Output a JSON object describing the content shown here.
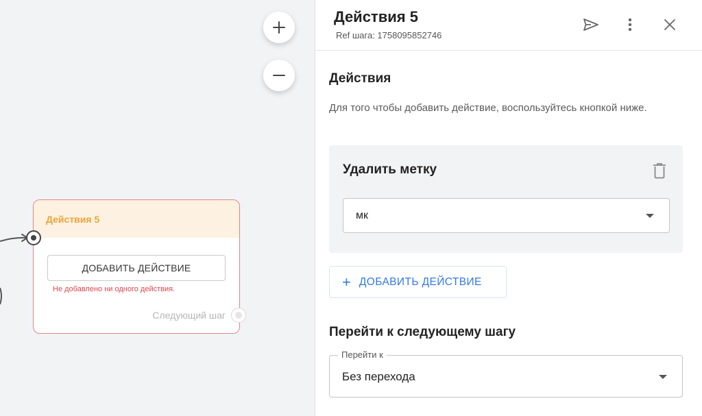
{
  "canvas": {
    "zoom_in_label": "+",
    "zoom_out_label": "−",
    "node": {
      "title": "Действия 5",
      "add_button": "ДОБАВИТЬ ДЕЙСТВИЕ",
      "error": "Не добавлено ни одного действия.",
      "next_step": "Следующий шаг"
    }
  },
  "panel": {
    "title": "Действия 5",
    "ref": "Ref шага: 1758095852746",
    "icons": [
      "send-icon",
      "more-vertical-icon",
      "close-icon"
    ],
    "actions_section": {
      "title": "Действия",
      "hint": "Для того чтобы добавить действие, воспользуйтесь кнопкой ниже.",
      "action": {
        "name": "Удалить метку",
        "tag_value": "мк"
      },
      "add_button": "ДОБАВИТЬ ДЕЙСТВИЕ"
    },
    "next_section": {
      "title": "Перейти к следующему шагу",
      "field_label": "Перейти к",
      "field_value": "Без перехода"
    }
  },
  "colors": {
    "accent": "#2f7ae5",
    "node_border": "#e5858a",
    "node_title": "#eda43a",
    "error": "#e0454b"
  }
}
